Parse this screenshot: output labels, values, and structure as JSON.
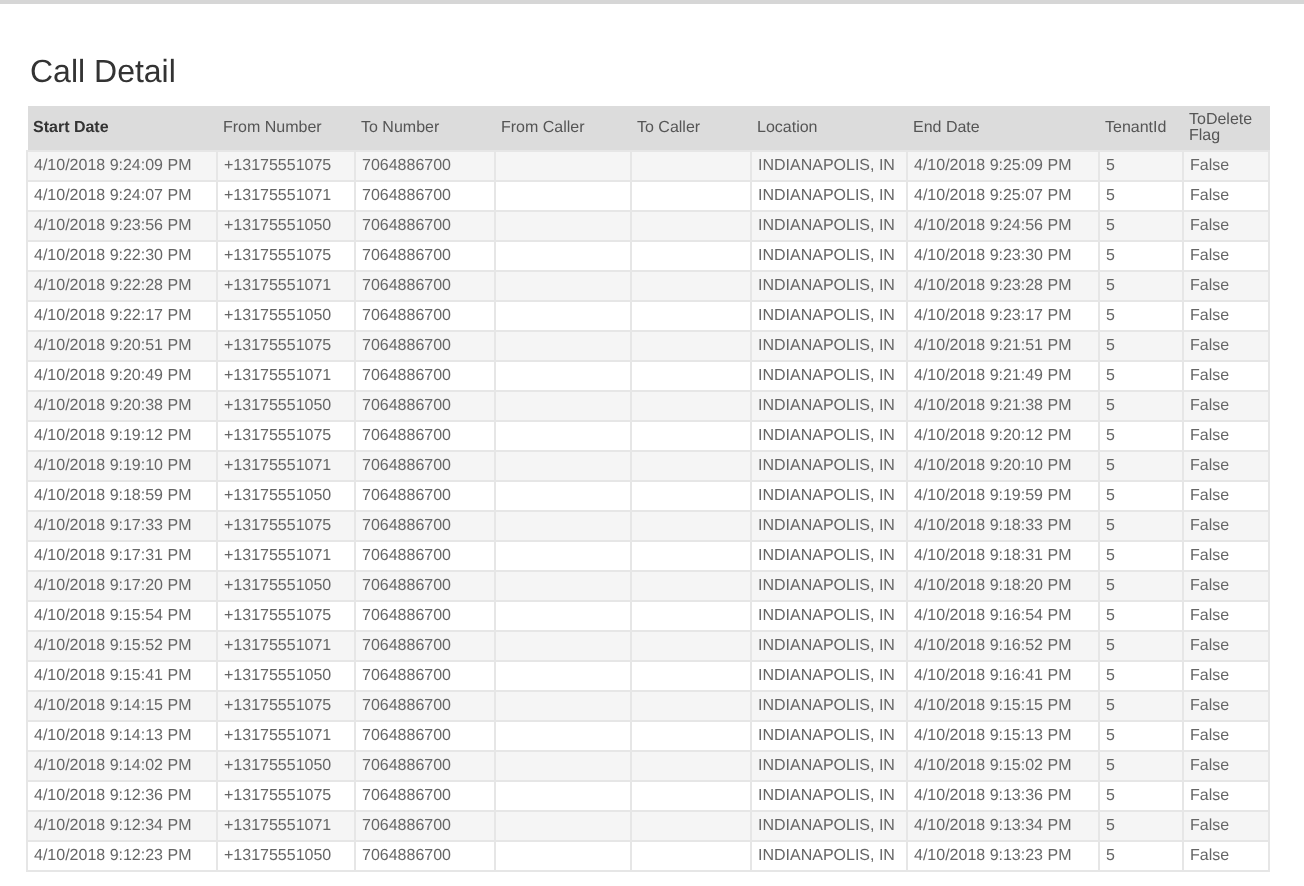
{
  "title": "Call Detail",
  "columns": [
    "Start Date",
    "From Number",
    "To Number",
    "From Caller",
    "To Caller",
    "Location",
    "End Date",
    "TenantId",
    "ToDelete Flag"
  ],
  "rows": [
    {
      "start": "4/10/2018 9:24:09 PM",
      "from": "+13175551075",
      "to": "7064886700",
      "location": "INDIANAPOLIS, IN",
      "end": "4/10/2018 9:25:09 PM",
      "tenant": "5",
      "flag": "False"
    },
    {
      "start": "4/10/2018 9:24:07 PM",
      "from": "+13175551071",
      "to": "7064886700",
      "location": "INDIANAPOLIS, IN",
      "end": "4/10/2018 9:25:07 PM",
      "tenant": "5",
      "flag": "False"
    },
    {
      "start": "4/10/2018 9:23:56 PM",
      "from": "+13175551050",
      "to": "7064886700",
      "location": "INDIANAPOLIS, IN",
      "end": "4/10/2018 9:24:56 PM",
      "tenant": "5",
      "flag": "False"
    },
    {
      "start": "4/10/2018 9:22:30 PM",
      "from": "+13175551075",
      "to": "7064886700",
      "location": "INDIANAPOLIS, IN",
      "end": "4/10/2018 9:23:30 PM",
      "tenant": "5",
      "flag": "False"
    },
    {
      "start": "4/10/2018 9:22:28 PM",
      "from": "+13175551071",
      "to": "7064886700",
      "location": "INDIANAPOLIS, IN",
      "end": "4/10/2018 9:23:28 PM",
      "tenant": "5",
      "flag": "False"
    },
    {
      "start": "4/10/2018 9:22:17 PM",
      "from": "+13175551050",
      "to": "7064886700",
      "location": "INDIANAPOLIS, IN",
      "end": "4/10/2018 9:23:17 PM",
      "tenant": "5",
      "flag": "False"
    },
    {
      "start": "4/10/2018 9:20:51 PM",
      "from": "+13175551075",
      "to": "7064886700",
      "location": "INDIANAPOLIS, IN",
      "end": "4/10/2018 9:21:51 PM",
      "tenant": "5",
      "flag": "False"
    },
    {
      "start": "4/10/2018 9:20:49 PM",
      "from": "+13175551071",
      "to": "7064886700",
      "location": "INDIANAPOLIS, IN",
      "end": "4/10/2018 9:21:49 PM",
      "tenant": "5",
      "flag": "False"
    },
    {
      "start": "4/10/2018 9:20:38 PM",
      "from": "+13175551050",
      "to": "7064886700",
      "location": "INDIANAPOLIS, IN",
      "end": "4/10/2018 9:21:38 PM",
      "tenant": "5",
      "flag": "False"
    },
    {
      "start": "4/10/2018 9:19:12 PM",
      "from": "+13175551075",
      "to": "7064886700",
      "location": "INDIANAPOLIS, IN",
      "end": "4/10/2018 9:20:12 PM",
      "tenant": "5",
      "flag": "False"
    },
    {
      "start": "4/10/2018 9:19:10 PM",
      "from": "+13175551071",
      "to": "7064886700",
      "location": "INDIANAPOLIS, IN",
      "end": "4/10/2018 9:20:10 PM",
      "tenant": "5",
      "flag": "False"
    },
    {
      "start": "4/10/2018 9:18:59 PM",
      "from": "+13175551050",
      "to": "7064886700",
      "location": "INDIANAPOLIS, IN",
      "end": "4/10/2018 9:19:59 PM",
      "tenant": "5",
      "flag": "False"
    },
    {
      "start": "4/10/2018 9:17:33 PM",
      "from": "+13175551075",
      "to": "7064886700",
      "location": "INDIANAPOLIS, IN",
      "end": "4/10/2018 9:18:33 PM",
      "tenant": "5",
      "flag": "False"
    },
    {
      "start": "4/10/2018 9:17:31 PM",
      "from": "+13175551071",
      "to": "7064886700",
      "location": "INDIANAPOLIS, IN",
      "end": "4/10/2018 9:18:31 PM",
      "tenant": "5",
      "flag": "False"
    },
    {
      "start": "4/10/2018 9:17:20 PM",
      "from": "+13175551050",
      "to": "7064886700",
      "location": "INDIANAPOLIS, IN",
      "end": "4/10/2018 9:18:20 PM",
      "tenant": "5",
      "flag": "False"
    },
    {
      "start": "4/10/2018 9:15:54 PM",
      "from": "+13175551075",
      "to": "7064886700",
      "location": "INDIANAPOLIS, IN",
      "end": "4/10/2018 9:16:54 PM",
      "tenant": "5",
      "flag": "False"
    },
    {
      "start": "4/10/2018 9:15:52 PM",
      "from": "+13175551071",
      "to": "7064886700",
      "location": "INDIANAPOLIS, IN",
      "end": "4/10/2018 9:16:52 PM",
      "tenant": "5",
      "flag": "False"
    },
    {
      "start": "4/10/2018 9:15:41 PM",
      "from": "+13175551050",
      "to": "7064886700",
      "location": "INDIANAPOLIS, IN",
      "end": "4/10/2018 9:16:41 PM",
      "tenant": "5",
      "flag": "False"
    },
    {
      "start": "4/10/2018 9:14:15 PM",
      "from": "+13175551075",
      "to": "7064886700",
      "location": "INDIANAPOLIS, IN",
      "end": "4/10/2018 9:15:15 PM",
      "tenant": "5",
      "flag": "False"
    },
    {
      "start": "4/10/2018 9:14:13 PM",
      "from": "+13175551071",
      "to": "7064886700",
      "location": "INDIANAPOLIS, IN",
      "end": "4/10/2018 9:15:13 PM",
      "tenant": "5",
      "flag": "False"
    },
    {
      "start": "4/10/2018 9:14:02 PM",
      "from": "+13175551050",
      "to": "7064886700",
      "location": "INDIANAPOLIS, IN",
      "end": "4/10/2018 9:15:02 PM",
      "tenant": "5",
      "flag": "False"
    },
    {
      "start": "4/10/2018 9:12:36 PM",
      "from": "+13175551075",
      "to": "7064886700",
      "location": "INDIANAPOLIS, IN",
      "end": "4/10/2018 9:13:36 PM",
      "tenant": "5",
      "flag": "False"
    },
    {
      "start": "4/10/2018 9:12:34 PM",
      "from": "+13175551071",
      "to": "7064886700",
      "location": "INDIANAPOLIS, IN",
      "end": "4/10/2018 9:13:34 PM",
      "tenant": "5",
      "flag": "False"
    },
    {
      "start": "4/10/2018 9:12:23 PM",
      "from": "+13175551050",
      "to": "7064886700",
      "location": "INDIANAPOLIS, IN",
      "end": "4/10/2018 9:13:23 PM",
      "tenant": "5",
      "flag": "False"
    }
  ]
}
